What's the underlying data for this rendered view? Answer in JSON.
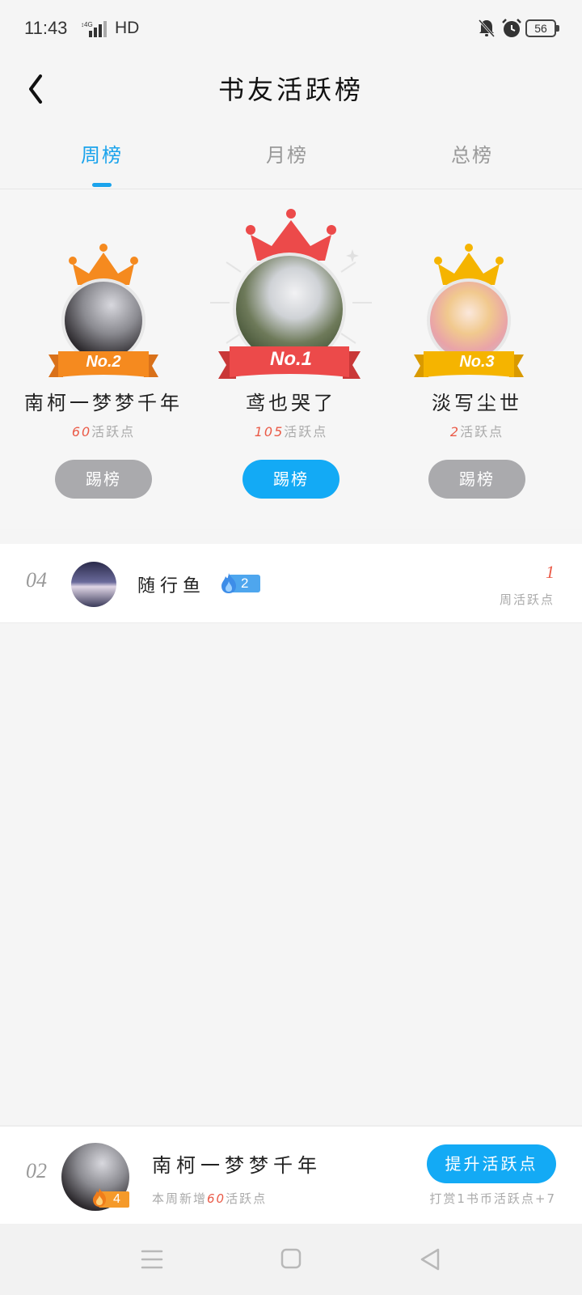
{
  "status_bar": {
    "time": "11:43",
    "network": "HD",
    "battery": "56"
  },
  "header": {
    "title": "书友活跃榜"
  },
  "tabs": [
    {
      "label": "周榜",
      "active": true
    },
    {
      "label": "月榜",
      "active": false
    },
    {
      "label": "总榜",
      "active": false
    }
  ],
  "podium": {
    "first": {
      "rank": "No.1",
      "name": "鸢也哭了",
      "points": "105",
      "points_suffix": "活跃点",
      "button": "踢榜"
    },
    "second": {
      "rank": "No.2",
      "name": "南柯一梦梦千年",
      "points": "60",
      "points_suffix": "活跃点",
      "button": "踢榜"
    },
    "third": {
      "rank": "No.3",
      "name": "淡写尘世",
      "points": "2",
      "points_suffix": "活跃点",
      "button": "踢榜"
    }
  },
  "list": [
    {
      "rank": "04",
      "name": "随行鱼",
      "level": "2",
      "score": "1",
      "score_label": "周活跃点"
    }
  ],
  "my_rank": {
    "rank": "02",
    "name": "南柯一梦梦千年",
    "level": "4",
    "sub_prefix": "本周新增",
    "sub_points": "60",
    "sub_suffix": "活跃点",
    "button": "提升活跃点",
    "hint": "打赏1书币活跃点+7"
  },
  "colors": {
    "accent": "#13aaf5",
    "tab_active": "#1aa3ec",
    "points_red": "#ea5a47",
    "rank1": "#ec4a4a",
    "rank2": "#f58a1f",
    "rank3": "#f5b400",
    "button_gray": "#aaaaad"
  },
  "icons": {
    "back": "chevron-left-icon",
    "flame": "flame-icon",
    "crown": "crown-icon",
    "nav_menu": "menu-lines-icon",
    "nav_home": "square-icon",
    "nav_back": "triangle-back-icon"
  }
}
